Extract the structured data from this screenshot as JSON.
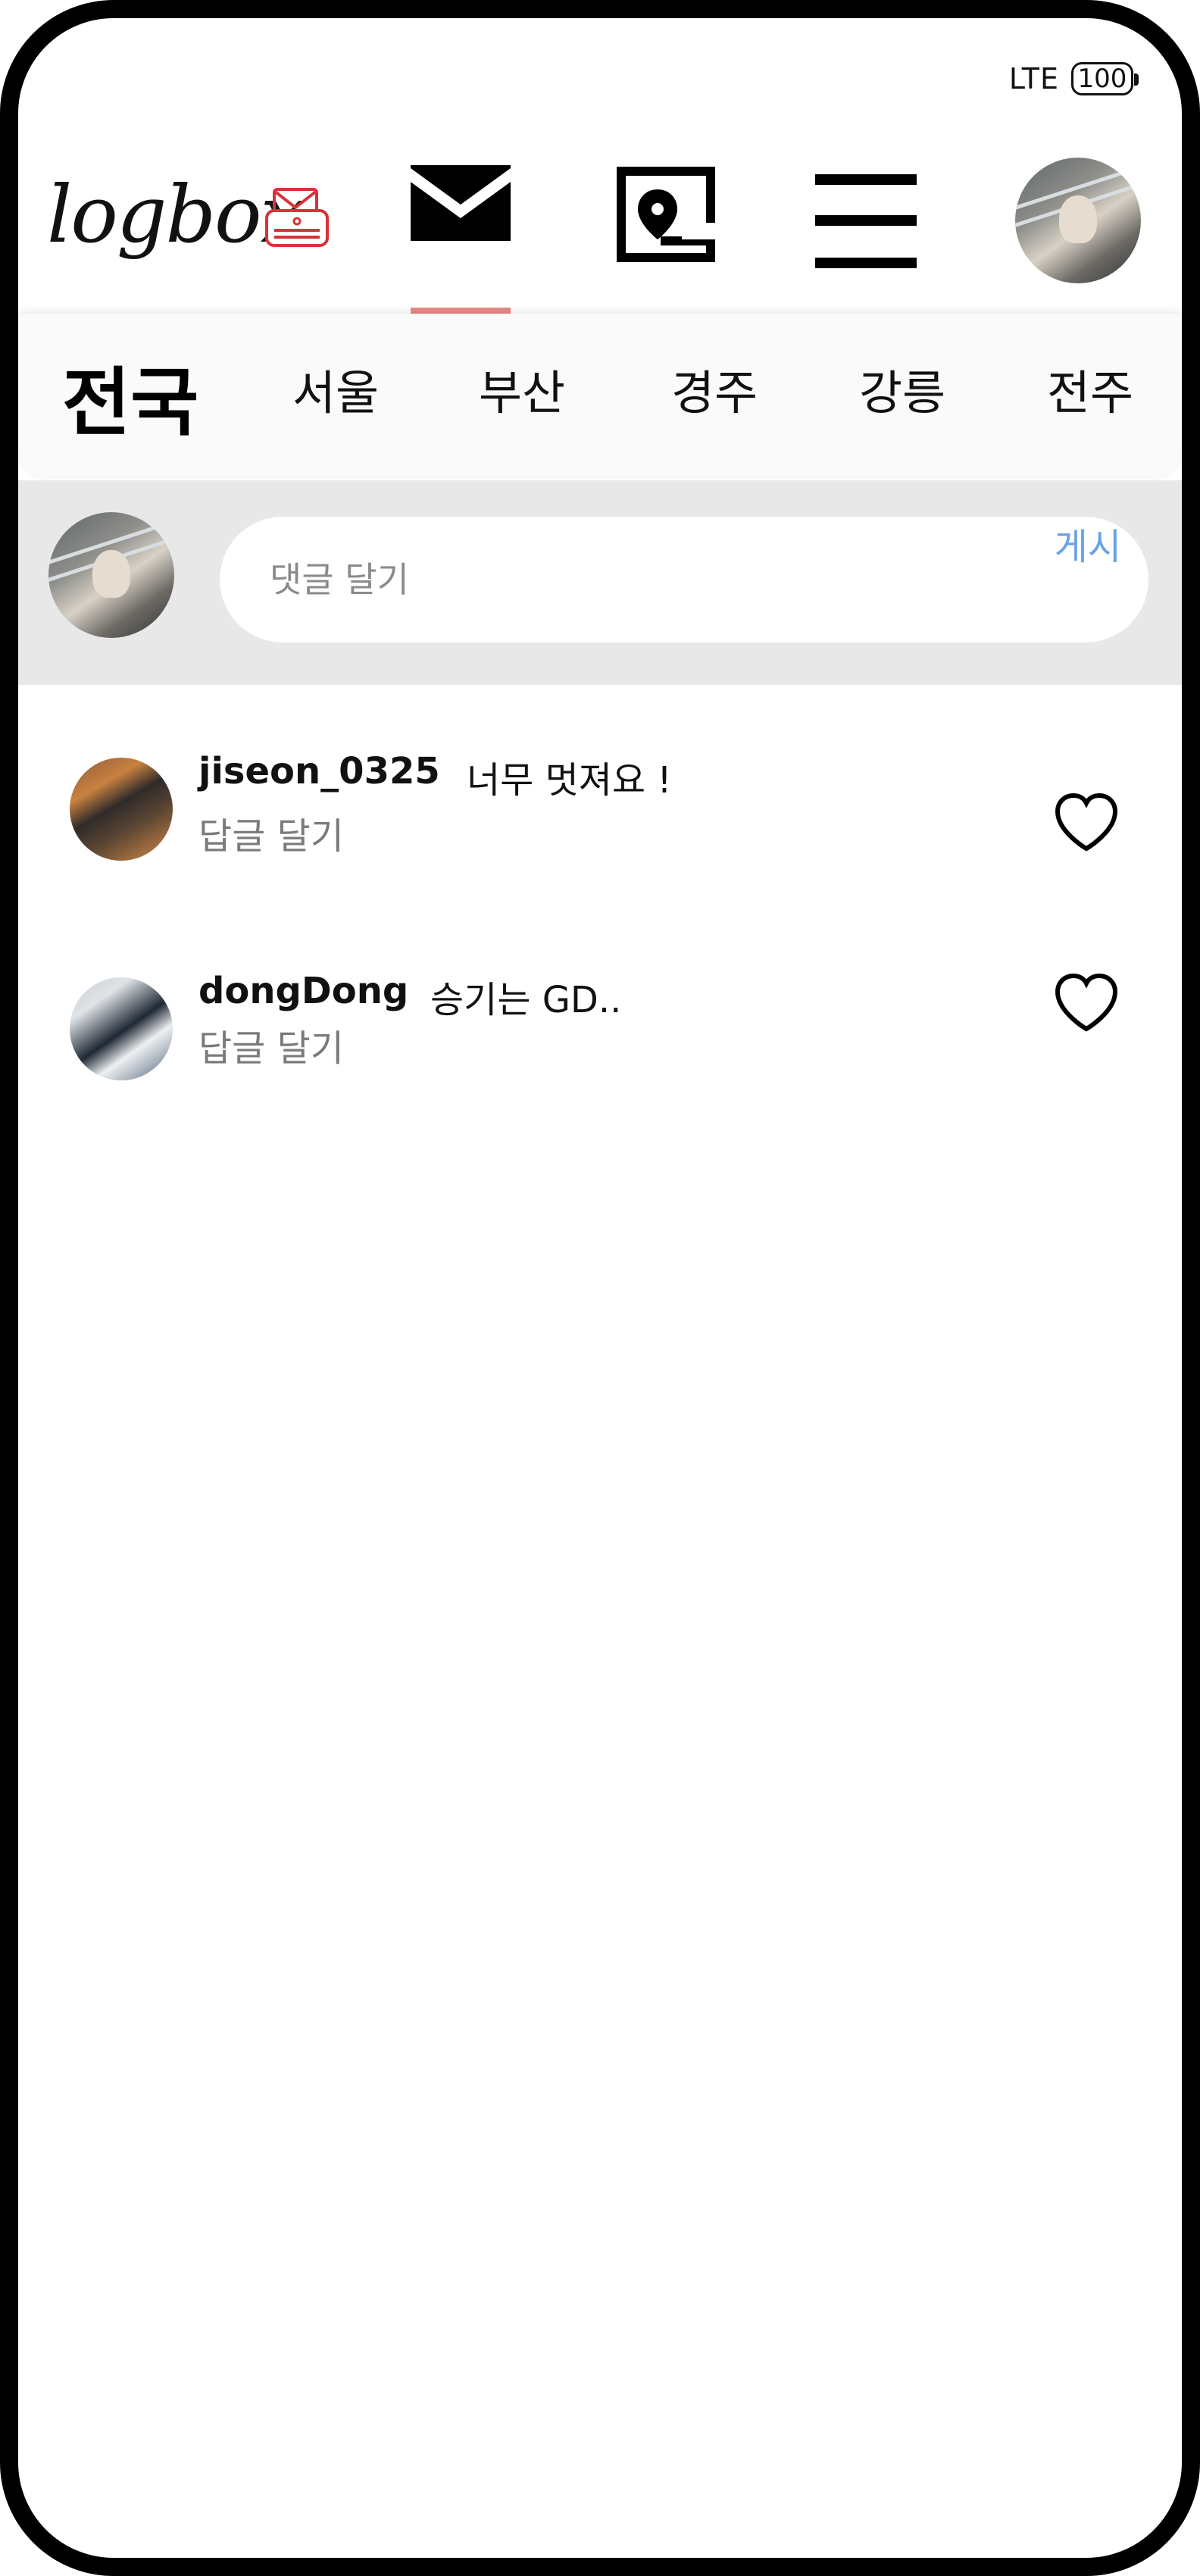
{
  "status_bar": {
    "network": "LTE",
    "battery": "100"
  },
  "header": {
    "logo": "logbox"
  },
  "regions": [
    "전국",
    "서울",
    "부산",
    "경주",
    "강릉",
    "전주"
  ],
  "comment_input": {
    "placeholder": "댓글 달기",
    "post_label": "게시"
  },
  "comments": [
    {
      "user": "jiseon_0325",
      "text": "너무 멋져요 !",
      "reply_label": "답글 달기"
    },
    {
      "user": "dongDong",
      "text": "승기는 GD..",
      "reply_label": "답글 달기"
    }
  ],
  "colors": {
    "active_tab": "#e98a86",
    "post_button": "#6aa2e4",
    "logo_icon": "#d7333b"
  }
}
